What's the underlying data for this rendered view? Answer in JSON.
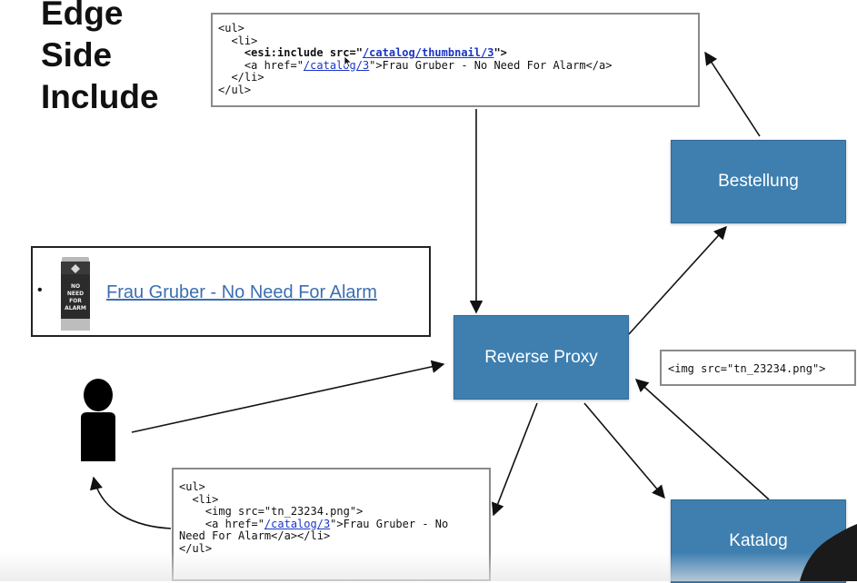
{
  "title": {
    "line1": "Edge",
    "line2": "Side",
    "line3": "Include"
  },
  "code_esi": {
    "l1": "<ul>",
    "l2": "  <li>",
    "l3_pre": "    <esi:include src=\"",
    "l3_link": "/catalog/thumbnail/3",
    "l3_post": "\">",
    "l4_pre": "    <a href=\"",
    "l4_link": "/catalog/3",
    "l4_post": "\">Frau Gruber - No Need For Alarm</a>",
    "l5": "  </li>",
    "l6": "</ul>"
  },
  "code_output": {
    "l1": "<ul>",
    "l2": "  <li>",
    "l3": "    <img src=\"tn_23234.png\">",
    "l4_pre": "    <a href=\"",
    "l4_link": "/catalog/3",
    "l4_post": "\">Frau Gruber - No",
    "l5": "Need For Alarm</a></li>",
    "l6": "</ul>"
  },
  "code_img": {
    "text": "<img src=\"tn_23234.png\">"
  },
  "nodes": {
    "bestellung": "Bestellung",
    "proxy": "Reverse Proxy",
    "katalog": "Katalog"
  },
  "preview": {
    "bullet": "•",
    "link": "Frau Gruber - No Need For Alarm",
    "can_text": "NO NEED FOR ALARM"
  },
  "colors": {
    "node_fill": "#3e7fb0",
    "link": "#1a35c7",
    "preview_link": "#3b6fb0"
  }
}
